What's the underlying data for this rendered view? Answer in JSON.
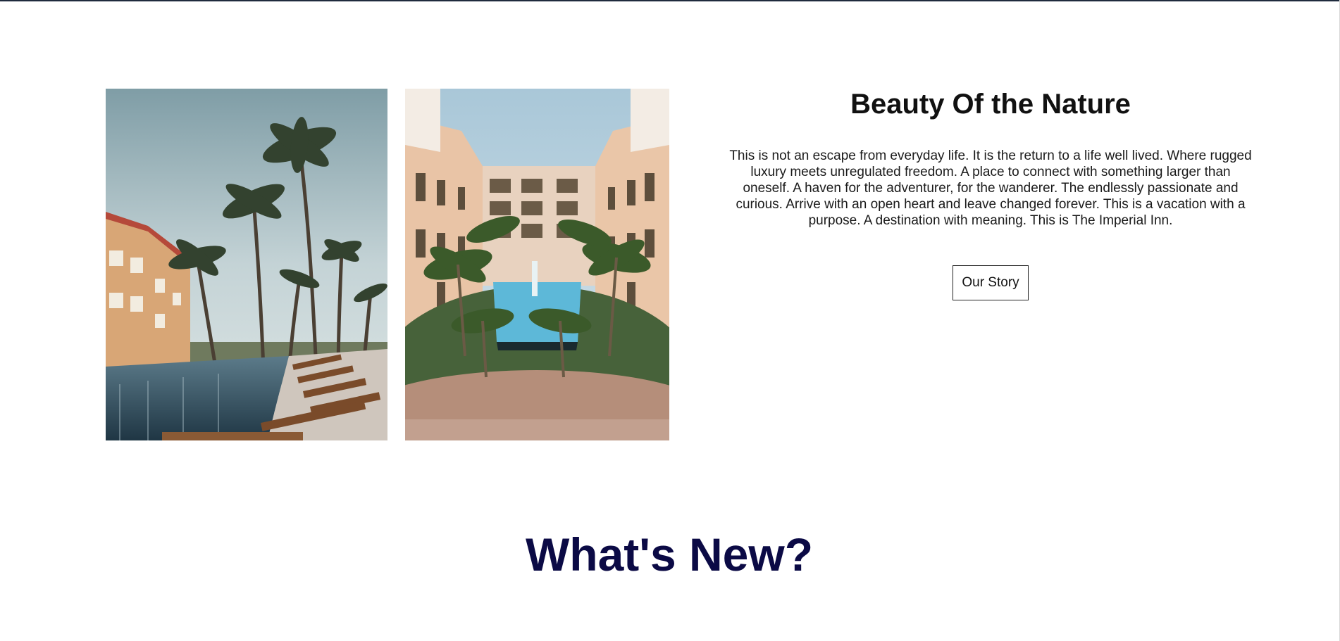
{
  "about": {
    "title": "Beauty Of the Nature",
    "description": "This is not an escape from everyday life. It is the return to a life well lived. Where rugged luxury meets unregulated freedom. A place to connect with something larger than oneself. A haven for the adventurer, for the wanderer. The endlessly passionate and curious. Arrive with an open heart and leave changed forever. This is a vacation with a purpose. A destination with meaning. This is The Imperial Inn.",
    "button_label": "Our Story"
  },
  "news": {
    "heading": "What's New?"
  },
  "colors": {
    "heading_accent": "#0b0a45",
    "text": "#111111",
    "top_border": "#1f2b3d"
  }
}
